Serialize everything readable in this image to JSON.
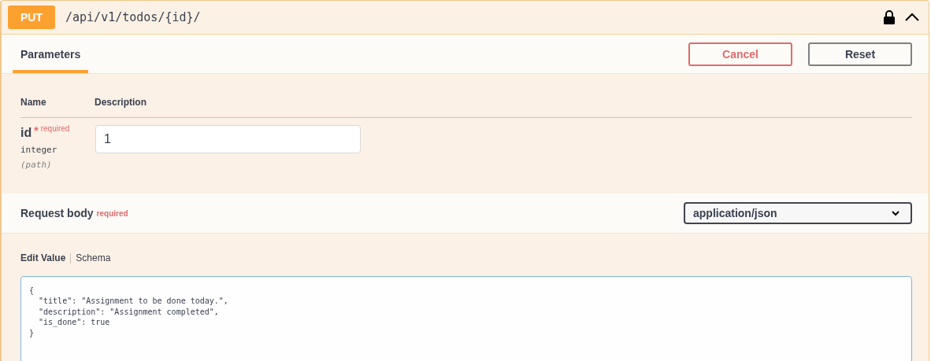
{
  "operation": {
    "method": "PUT",
    "path": "/api/v1/todos/{id}/",
    "locked": true,
    "expanded": true
  },
  "tabs": [
    {
      "label": "Parameters",
      "selected": true
    }
  ],
  "buttons": [
    {
      "label": "Cancel",
      "kind": "cancel"
    },
    {
      "label": "Reset",
      "kind": "reset"
    }
  ],
  "parameters": {
    "columns": [
      "Name",
      "Description"
    ],
    "rows": [
      {
        "name": "id",
        "required_mark": "*",
        "required_label": "required",
        "type": "integer",
        "location": "(path)",
        "value": "1"
      }
    ]
  },
  "request_body": {
    "label": "Request body",
    "required_label": "required",
    "content_type": "application/json",
    "tabs": [
      {
        "label": "Edit Value",
        "selected": true
      },
      {
        "label": "Schema",
        "selected": false
      }
    ],
    "value": "{\n  \"title\": \"Assignment to be done today.\",\n  \"description\": \"Assignment completed\",\n  \"is_done\": true\n}"
  }
}
